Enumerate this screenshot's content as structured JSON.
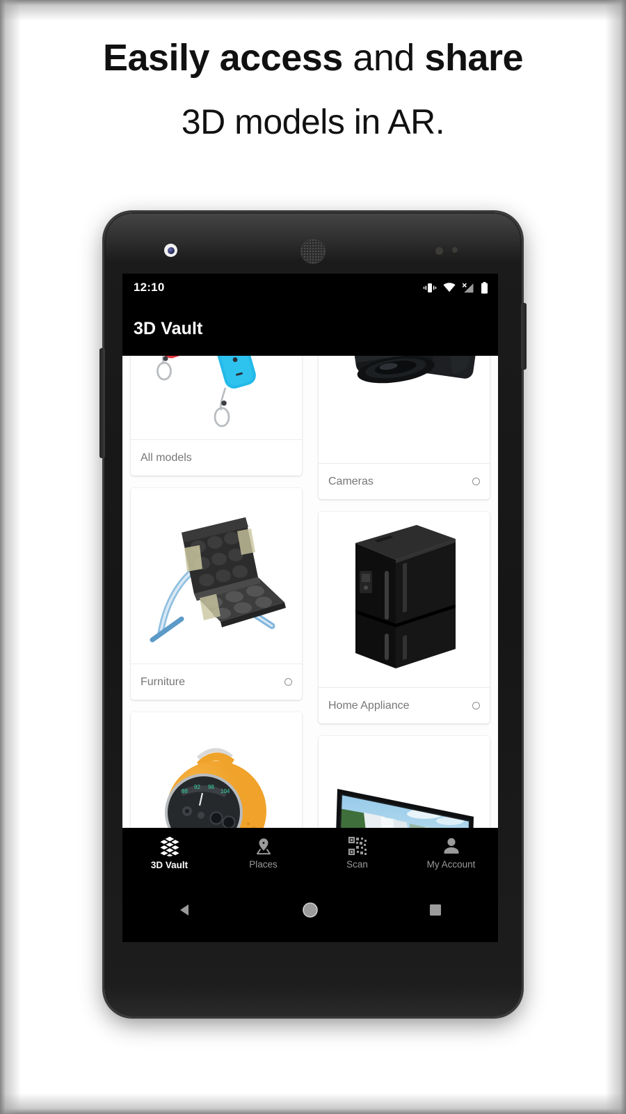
{
  "promo": {
    "headline_line1_part1": "Easily access",
    "headline_line1_part2": " and ",
    "headline_line1_part3": "share",
    "headline_line2": "3D models in AR."
  },
  "device": {
    "hardware": {
      "front_camera": "front-camera",
      "earpiece": "earpiece-speaker",
      "power_button": "power-button",
      "volume_button": "volume-rocker"
    }
  },
  "status_bar": {
    "time": "12:10",
    "icons": [
      "vibrate-icon",
      "wifi-icon",
      "cellular-signal-no-service-icon",
      "battery-icon"
    ]
  },
  "app_bar": {
    "title": "3D Vault"
  },
  "grid": {
    "left_column": [
      {
        "label": "All models",
        "image": "nintendo-switch-joycons",
        "has_indicator": false,
        "media_height": "short"
      },
      {
        "label": "Furniture",
        "image": "barcelona-chair",
        "has_indicator": true,
        "media_height": "tall"
      },
      {
        "label": "",
        "image": "orange-sphere-radio",
        "has_indicator": false,
        "media_height": "tall"
      }
    ],
    "right_column": [
      {
        "label": "Cameras",
        "image": "dslr-camera-lens",
        "has_indicator": true,
        "media_height": "short"
      },
      {
        "label": "Home Appliance",
        "image": "black-refrigerator",
        "has_indicator": true,
        "media_height": "tall"
      },
      {
        "label": "",
        "image": "flat-screen-tv",
        "has_indicator": false,
        "media_height": "tall"
      }
    ]
  },
  "tab_bar": {
    "items": [
      {
        "label": "3D Vault",
        "icon": "cube-grid-icon",
        "active": true
      },
      {
        "label": "Places",
        "icon": "map-pin-icon",
        "active": false
      },
      {
        "label": "Scan",
        "icon": "qr-scan-icon",
        "active": false
      },
      {
        "label": "My Account",
        "icon": "person-icon",
        "active": false
      }
    ]
  },
  "system_nav": {
    "buttons": [
      "back-button",
      "home-button",
      "recents-button"
    ]
  },
  "colors": {
    "bar_background": "#000000",
    "active_tab": "#ffffff",
    "inactive_tab": "#9a9a9a",
    "card_label": "#767676",
    "page_background": "#ffffff"
  }
}
